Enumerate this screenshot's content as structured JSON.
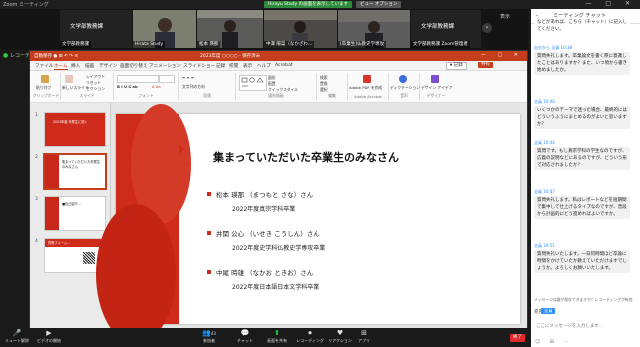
{
  "window": {
    "title": "Zoom ミーティング",
    "controls": "— □ ✕"
  },
  "share_banner": "Hirayu Study の画面を表示しています",
  "view_options": "ビュー オプション",
  "video_tiles": [
    {
      "big_name": "文学部教務課",
      "tag": "文学部教務課"
    },
    {
      "big_name": "",
      "tag": "Hirata Study"
    },
    {
      "big_name": "",
      "tag": "松本 瑛那"
    },
    {
      "big_name": "",
      "tag": "中澤 陽菜（なかざわ…"
    },
    {
      "big_name": "",
      "tag": "[卒業生]仏教史学専攻"
    },
    {
      "big_name": "文学部教務課",
      "tag": "文学部教務課 Zoom管理者"
    }
  ],
  "view_label": "表示",
  "record_label": "レコーディング中",
  "ppt": {
    "menu": "自動保存 ● ⊞ ↶ ↷ ≡",
    "doc_title": "2023年度 ○○○○ - 保存済み",
    "win_controls": "— □ ✕",
    "tabs": [
      "ファイル",
      "ホーム",
      "挿入",
      "描画",
      "デザイン",
      "画面切り替え",
      "アニメーション",
      "スライドショー",
      "記録",
      "校閲",
      "表示",
      "ヘルプ",
      "Acrobat"
    ],
    "record_btn": "⏺ 記録",
    "share_btn": "共有",
    "ribbon_groups": [
      {
        "label": "クリップボード",
        "items": [
          "貼り付け"
        ]
      },
      {
        "label": "スライド",
        "items": [
          "新しいスライド",
          "レイアウト",
          "リセット",
          "セクション"
        ]
      },
      {
        "label": "フォント",
        "items": [
          "B I U S ab",
          "A  Aa"
        ]
      },
      {
        "label": "段落",
        "items": [
          "≡ ≡ ≡",
          "文字列の方向"
        ]
      },
      {
        "label": "図形描画",
        "items": [
          "図形",
          "配置",
          "クイックスタイル"
        ]
      },
      {
        "label": "編集",
        "items": [
          "検索",
          "置換",
          "選択"
        ]
      },
      {
        "label": "Adobe Acrobat",
        "items": [
          "Adobe PDF を作成"
        ]
      },
      {
        "label": "音声",
        "items": [
          "ディクテーション"
        ]
      },
      {
        "label": "デザイナー",
        "items": [
          "デザイン アイデア"
        ]
      }
    ],
    "thumbnails": [
      {
        "num": "1",
        "text": "2023年度 卒業生に聞く"
      },
      {
        "num": "2",
        "text": "集まっていただいた卒業生のみなさん"
      },
      {
        "num": "3",
        "text": "■自己紹介…"
      },
      {
        "num": "4",
        "text": "質問フォーム…"
      }
    ],
    "slide": {
      "heading": "集まっていただいた卒業生のみなさん",
      "people": [
        {
          "name": "松本 瑛那 （まつもと さな）さん",
          "detail": "2022年度真宗学科卒業"
        },
        {
          "name": "井関 公心 （いせき こうしん）さん",
          "detail": "2022年度史学科仏教史学専攻卒業"
        },
        {
          "name": "中尾 時雄 （なかお ときお）さん",
          "detail": "2022年度日本語日本文学科卒業"
        }
      ]
    }
  },
  "chat": {
    "title": "ミーティング チャット",
    "messages": [
      {
        "from": "",
        "body": "などがあれば、こちら（チャット）に記入してください。"
      },
      {
        "from": "自分から 全員 10:38",
        "body": "質問失礼します。卒業論文を書く際に意識したことはありますか？また、いつ頃から書き始めましたか。"
      },
      {
        "from": "全員 10:40",
        "body": "いくつかのテーマで迷った場合、最終的にはどういうふうにまとめるのがよいと思いますか？"
      },
      {
        "from": "全員 10:44",
        "body": "質問です。もし真宗学科の学生なのですが、広義の説明などにあるのですが、どういう形で対応されましたか？"
      },
      {
        "from": "全員 10:47",
        "body": "質問失礼します。私はレポートなどを短期間で集中して仕上げるタイプなのですが、普段から計画的にどう進めればよいですか。"
      },
      {
        "from": "全員 10:51",
        "body": "質問失礼いたします。一日何時間ほど卒論に時間をかけていたか教えていただけますでしょうか。よろしくお願いいたします。"
      }
    ],
    "notice": "メッセージは誰が保存できますか？レコーディングが有効",
    "to_label": "宛先:",
    "to_value": "全員",
    "input_placeholder": "ここにメッセージを入力します...",
    "tools": "☺ ⊞ ⋯"
  },
  "toolbar": {
    "items": [
      {
        "icon": "🎤",
        "label": "ミュート解除"
      },
      {
        "icon": "▶",
        "label": "ビデオの開始"
      },
      {
        "icon": "👥",
        "label": "参加者"
      },
      {
        "icon": "💬",
        "label": "チャット"
      },
      {
        "icon": "⬆",
        "label": "画面を共有"
      },
      {
        "icon": "⏺",
        "label": "レコーディング"
      },
      {
        "icon": "♥",
        "label": "リアクション"
      },
      {
        "icon": "⊞",
        "label": "アプリ"
      }
    ],
    "participants_count": "43",
    "end_label": "終了"
  },
  "colors": {
    "ppt_red": "#c43e1c",
    "slide_red": "#cf2b1b",
    "zoom_blue": "#2d8cff",
    "share_green": "#2ecc40"
  }
}
